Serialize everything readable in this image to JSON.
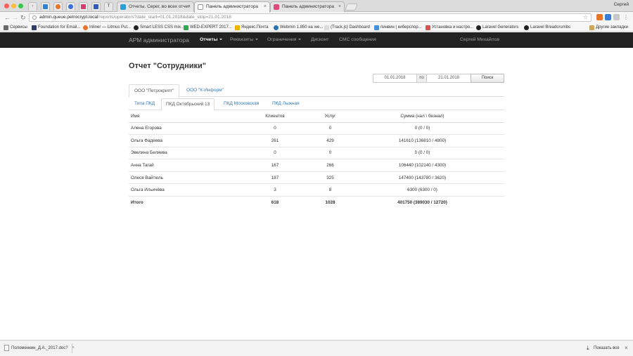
{
  "browser": {
    "user": "Сергей",
    "tabs": [
      {
        "title": "Отчеты. Серег, во всех отчет"
      },
      {
        "title": "Панель администратора"
      },
      {
        "title": "Панель администратора"
      }
    ],
    "url_host": "admin.queue.petrocrypt.local",
    "url_rest": "/reports/operators?date_start=01.01.2018&date_stop=21.01.2018",
    "bookmarks": [
      "Сервисы",
      "Foundation for Email...",
      "Inliner — Litmus Put...",
      "Smart LESS CSS mix...",
      "WED-EXPERT 2017...",
      "Яндекс.Почта",
      "Webmin 1.850 на we...",
      "(Track.js) Dashboard",
      "пинвин | киберспор...",
      "Установка и настро...",
      "Laravel Generators",
      "Laravel Breadcrumbs",
      "Другие закладки"
    ]
  },
  "navbar": {
    "brand": "АРМ администратора",
    "items": [
      {
        "label": "Отчеты",
        "active": true
      },
      {
        "label": "Реквизиты"
      },
      {
        "label": "Ограничения"
      },
      {
        "label": "Дисконт"
      },
      {
        "label": "СМС сообщения"
      }
    ],
    "user": "Сергей Михайлов"
  },
  "page": {
    "title": "Отчет \"Сотрудники\"",
    "date_start": "01.01.2018",
    "date_sep": "по",
    "date_stop": "21.01.2018",
    "search_label": "Поиск"
  },
  "company_tabs": [
    {
      "label": "ООО \"Петрокрипт\"",
      "active": true
    },
    {
      "label": "ООО \"К-Информ\""
    }
  ],
  "point_tabs": [
    {
      "label": "Типа ПКД"
    },
    {
      "label": "ПКД Октябрьский 13",
      "active": true
    },
    {
      "label": "ПКД Московская"
    },
    {
      "label": "ПКД Лыжная"
    }
  ],
  "table": {
    "headers": [
      "Имя",
      "Клиентов",
      "Услуг",
      "Сумма (нал \\ безнал)"
    ],
    "rows": [
      [
        "Алена Егорова",
        "0",
        "0",
        "0 (0 / 0)"
      ],
      [
        "Ольга Фадеева",
        "261",
        "429",
        "141610 (136810 / 4800)"
      ],
      [
        "Эвелина Беляева",
        "0",
        "0",
        "0 (0 / 0)"
      ],
      [
        "Анна Тагай",
        "167",
        "266",
        "106440 (102140 / 4300)"
      ],
      [
        "Олеся Вайтюль",
        "187",
        "325",
        "147400 (143780 / 3620)"
      ],
      [
        "Ольга Ильичёва",
        "3",
        "8",
        "6300 (6300 / 0)"
      ]
    ],
    "total": [
      "Итого",
      "618",
      "1028",
      "401750 (389030 / 12720)"
    ]
  },
  "downloads": {
    "file": "Поломенкин_Д.А._2017.doc?",
    "show_all": "Показать все"
  }
}
